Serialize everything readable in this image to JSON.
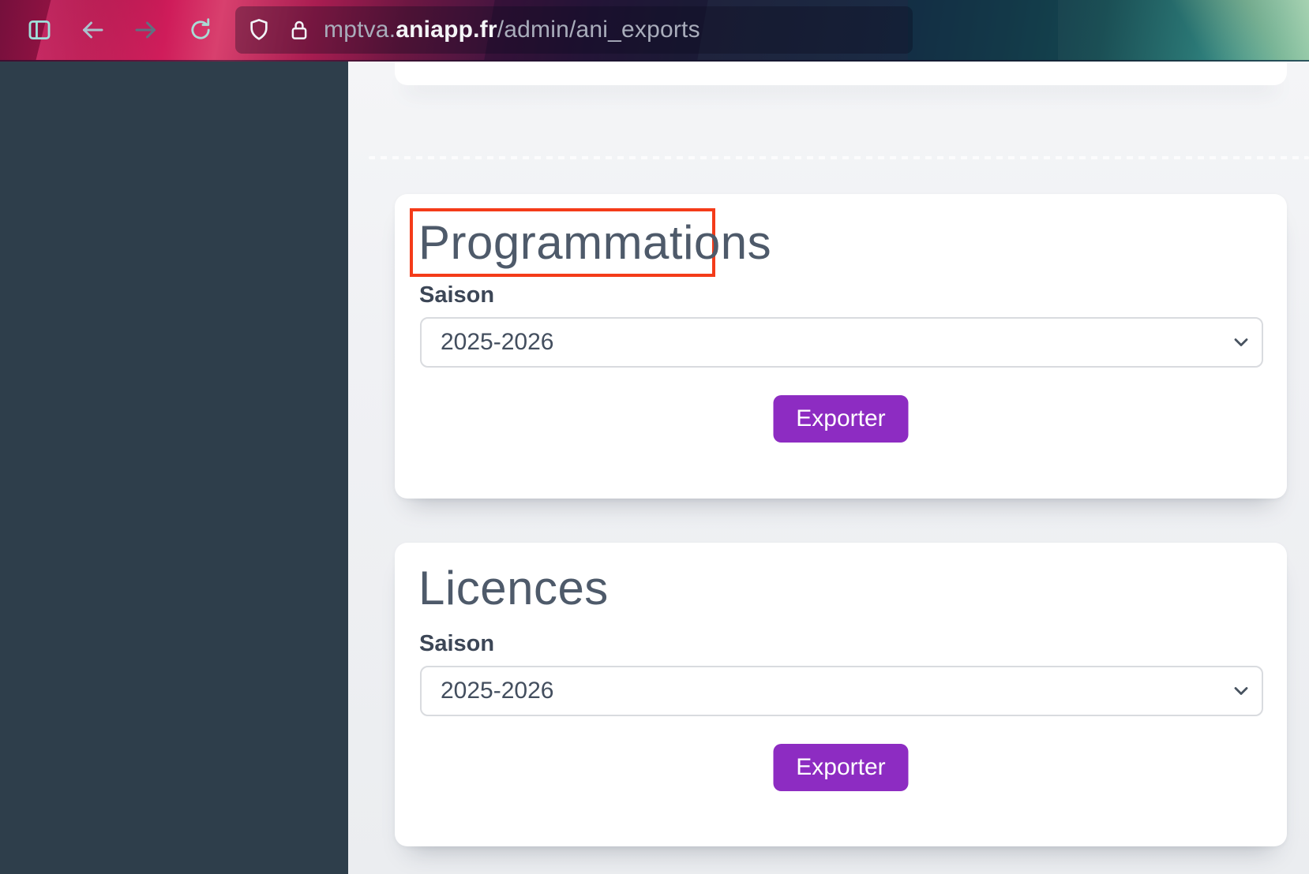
{
  "browser": {
    "url": {
      "subdomain": "mptva.",
      "domain": "aniapp.fr",
      "path": "/admin/ani_exports"
    },
    "toolbar_icons": [
      "sidebar-toggle",
      "back",
      "forward",
      "reload",
      "shield",
      "lock"
    ]
  },
  "main": {
    "cards": [
      {
        "title": "Programmations",
        "annotation": "red-box",
        "field_label": "Saison",
        "select_value": "2025-2026",
        "button_label": "Exporter"
      },
      {
        "title": "Licences",
        "field_label": "Saison",
        "select_value": "2025-2026",
        "button_label": "Exporter"
      }
    ]
  },
  "colors": {
    "accent_purple": "#8d2cc2",
    "annotation_red": "#f43b19",
    "sidebar": "#2e3e4b",
    "title_text": "#4e5a6a"
  }
}
